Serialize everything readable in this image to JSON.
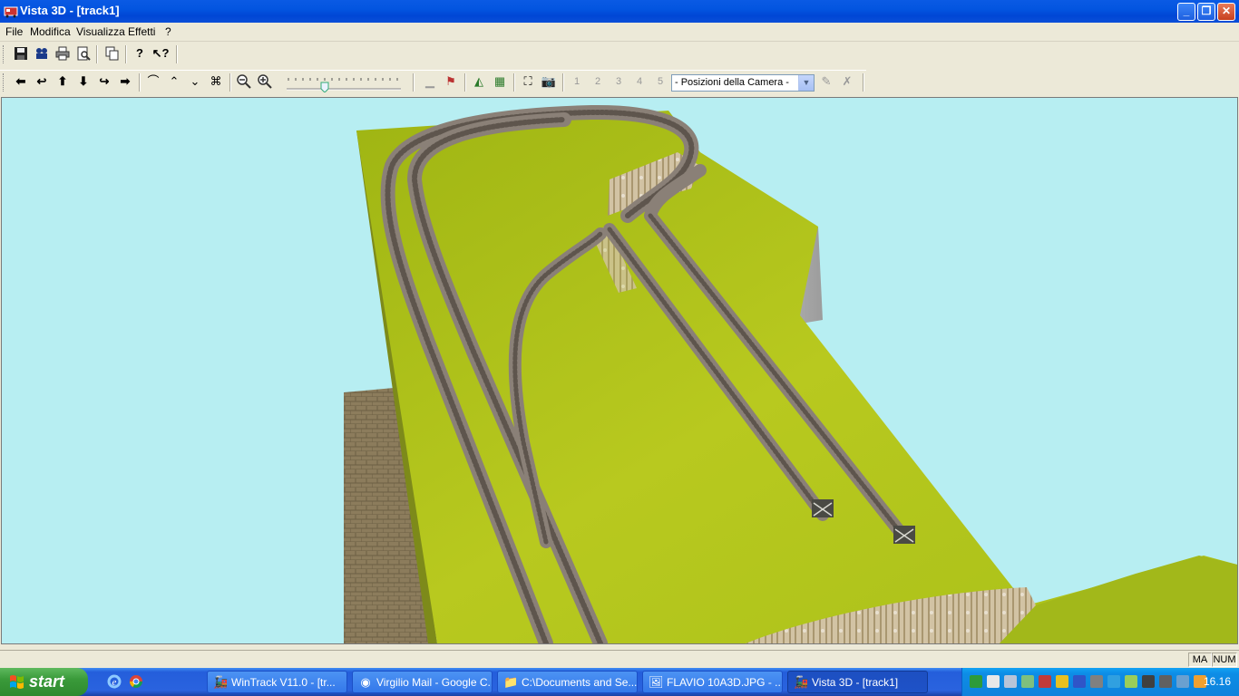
{
  "window": {
    "title": "Vista 3D - [track1]"
  },
  "menu": {
    "file": "File",
    "edit": "Modifica",
    "view": "Visualizza",
    "effects": "Effetti",
    "help": "?"
  },
  "camera_select": {
    "selected": "- Posizioni della Camera -"
  },
  "camera_presets": [
    "1",
    "2",
    "3",
    "4",
    "5"
  ],
  "statusbar": {
    "caps": "MA",
    "num": "NUM"
  },
  "taskbar": {
    "start_label": "start",
    "tasks": [
      {
        "label": "WinTrack  V11.0 - [tr..."
      },
      {
        "label": "Virgilio Mail - Google C..."
      },
      {
        "label": "C:\\Documents and Se..."
      },
      {
        "label": "FLAVIO 10A3D.JPG - ..."
      },
      {
        "label": "Vista 3D - [track1]"
      }
    ],
    "clock": "16.16"
  },
  "colors": {
    "sky": "#b7eef2",
    "terrain": "#b4c61a",
    "track_bed": "#8a8077",
    "cliff": "#c9b79a",
    "wall": "#8c7c5c"
  }
}
